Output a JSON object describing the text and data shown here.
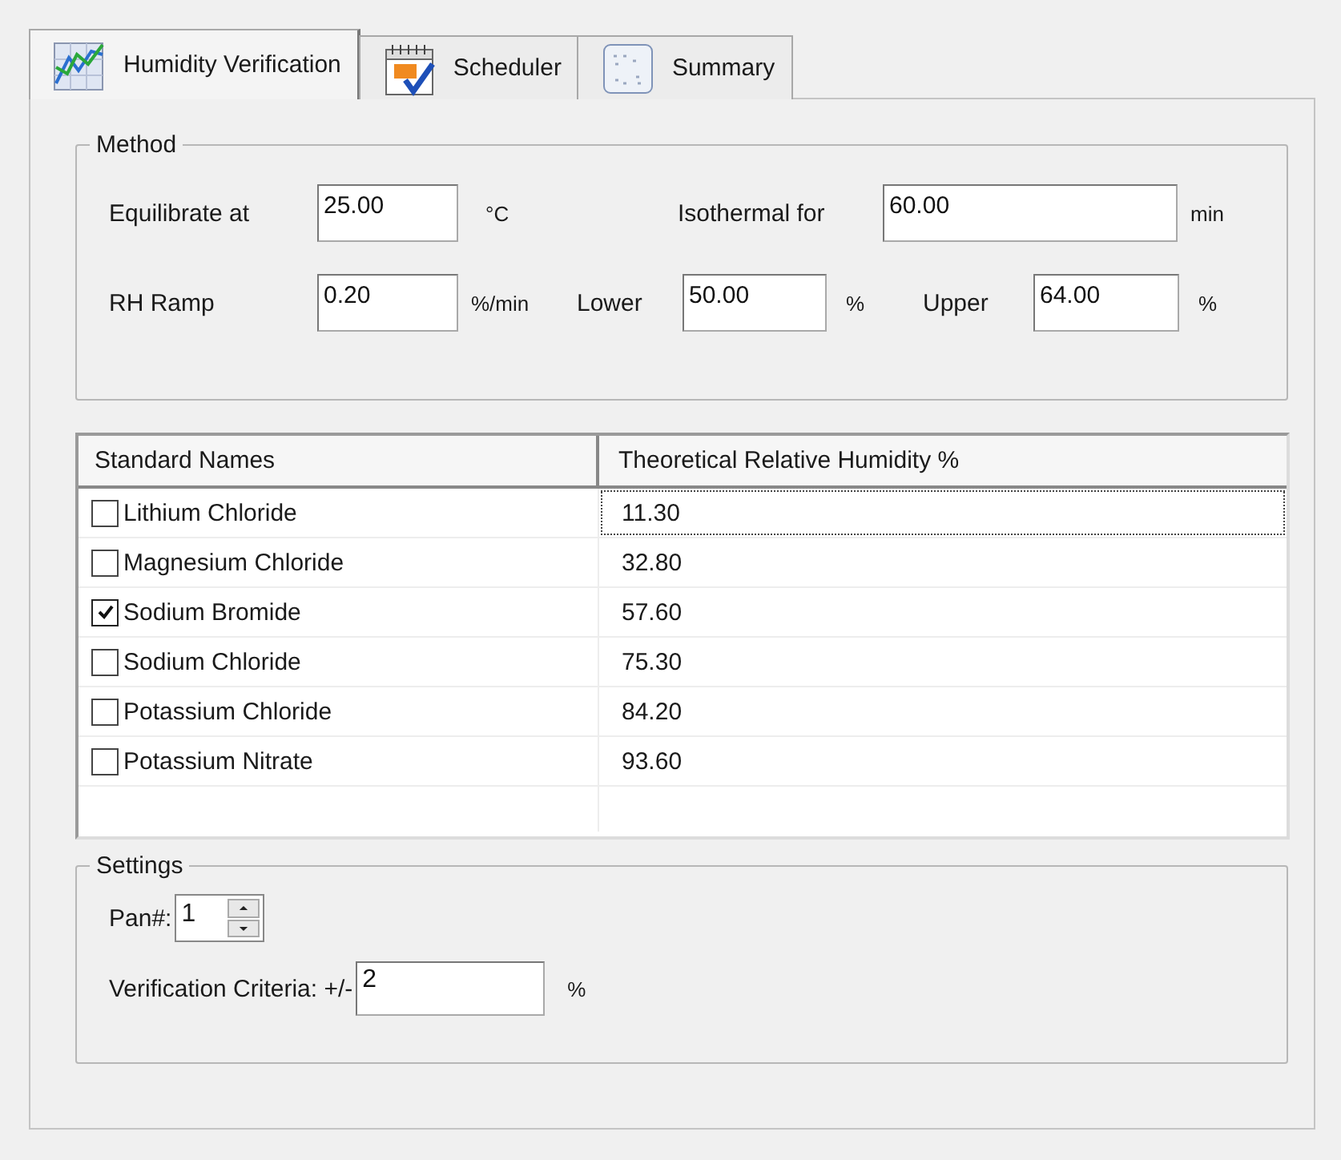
{
  "tabs": [
    {
      "label": "Humidity Verification",
      "selected": true
    },
    {
      "label": "Scheduler",
      "selected": false
    },
    {
      "label": "Summary",
      "selected": false
    }
  ],
  "method": {
    "title": "Method",
    "lines": [
      {
        "fields": [
          {
            "label": "Equilibrate at",
            "value": "25.00",
            "unit": "°C"
          },
          {
            "label": "Isothermal for",
            "value": "60.00",
            "unit": "min"
          }
        ]
      },
      {
        "fields": [
          {
            "label": "RH Ramp",
            "value": "0.20",
            "unit": "%/min"
          },
          {
            "label": "Lower",
            "value": "50.00",
            "unit": "%"
          },
          {
            "label": "Upper",
            "value": "64.00",
            "unit": "%"
          }
        ]
      }
    ]
  },
  "table": {
    "columns": [
      "Standard Names",
      "Theoretical Relative Humidity %"
    ],
    "rows": [
      {
        "name": "Lithium Chloride",
        "value": "11.30",
        "checked": false,
        "focused": true
      },
      {
        "name": "Magnesium Chloride",
        "value": "32.80",
        "checked": false,
        "focused": false
      },
      {
        "name": "Sodium Bromide",
        "value": "57.60",
        "checked": true,
        "focused": false
      },
      {
        "name": "Sodium Chloride",
        "value": "75.30",
        "checked": false,
        "focused": false
      },
      {
        "name": "Potassium Chloride",
        "value": "84.20",
        "checked": false,
        "focused": false
      },
      {
        "name": "Potassium Nitrate",
        "value": "93.60",
        "checked": false,
        "focused": false
      }
    ]
  },
  "settings": {
    "title": "Settings",
    "pan_label": "Pan#:",
    "pan_value": "1",
    "criteria_label": "Verification Criteria: +/-",
    "criteria_value": "2",
    "criteria_unit": "%"
  }
}
